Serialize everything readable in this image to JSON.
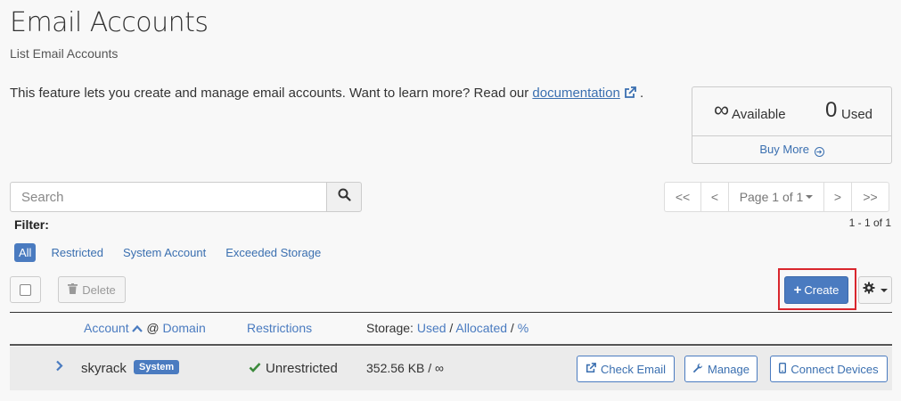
{
  "header": {
    "title": "Email Accounts",
    "subtitle": "List Email Accounts"
  },
  "intro": {
    "text": "This feature lets you create and manage email accounts. Want to learn more? Read our ",
    "link": "documentation",
    "suffix": "."
  },
  "stats": {
    "available_value": "∞",
    "available_label": "Available",
    "used_value": "0",
    "used_label": "Used",
    "buy_more": "Buy More"
  },
  "search": {
    "placeholder": "Search"
  },
  "pagination": {
    "first": "<<",
    "prev": "<",
    "page_label": "Page 1 of 1",
    "next": ">",
    "last": ">>",
    "range": "1 - 1 of 1"
  },
  "filter": {
    "label": "Filter:",
    "options": [
      "All",
      "Restricted",
      "System Account",
      "Exceeded Storage"
    ],
    "active": "All"
  },
  "toolbar": {
    "delete_label": "Delete",
    "create_label": "Create"
  },
  "table": {
    "headers": {
      "account": "Account",
      "at": "@",
      "domain": "Domain",
      "restrictions": "Restrictions",
      "storage_prefix": "Storage:",
      "used": "Used",
      "allocated": "Allocated",
      "percent": "%",
      "sep": "/"
    },
    "rows": [
      {
        "account": "skyrack",
        "badge": "System",
        "restriction": "Unrestricted",
        "storage": "352.56 KB / ∞",
        "actions": [
          "Check Email",
          "Manage",
          "Connect Devices"
        ]
      }
    ]
  },
  "colors": {
    "accent": "#4a7bc0",
    "link": "#3a6fb0",
    "highlight": "#d9262d",
    "success": "#3c8a3c"
  }
}
